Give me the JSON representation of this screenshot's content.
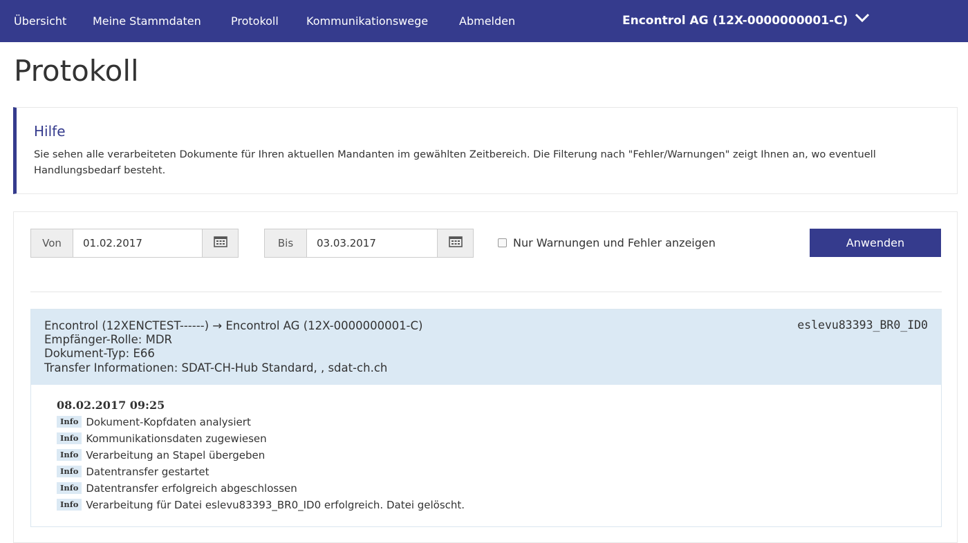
{
  "nav": {
    "items": [
      "Übersicht",
      "Meine Stammdaten",
      "Protokoll",
      "Kommunikationswege",
      "Abmelden"
    ],
    "tenant": "Encontrol AG (12X-0000000001-C)",
    "bg_color": "#353b8d"
  },
  "page": {
    "title": "Protokoll"
  },
  "help": {
    "title": "Hilfe",
    "text": "Sie sehen alle verarbeiteten Dokumente für Ihren aktuellen Mandanten im gewählten Zeitbereich. Die Filterung nach \"Fehler/Warnungen\" zeigt Ihnen an, wo eventuell Handlungsbedarf besteht."
  },
  "filter": {
    "from_label": "Von",
    "from_value": "01.02.2017",
    "to_label": "Bis",
    "to_value": "03.03.2017",
    "calendar_icon": "calendar-icon",
    "checkbox_label": "Nur Warnungen und Fehler anzeigen",
    "checkbox_checked": false,
    "apply_label": "Anwenden"
  },
  "entries": [
    {
      "route": "Encontrol (12XENCTEST------) → Encontrol AG (12X-0000000001-C)",
      "role": "Empfänger-Rolle: MDR",
      "doc_type": "Dokument-Typ: E66",
      "transfer": "Transfer Informationen: SDAT-CH-Hub Standard, , sdat-ch.ch",
      "file_id": "eslevu83393_BR0_ID0",
      "timestamp": "08.02.2017 09:25",
      "logs": [
        {
          "level": "Info",
          "text": "Dokument-Kopfdaten analysiert"
        },
        {
          "level": "Info",
          "text": "Kommunikationsdaten zugewiesen"
        },
        {
          "level": "Info",
          "text": "Verarbeitung an Stapel übergeben"
        },
        {
          "level": "Info",
          "text": "Datentransfer gestartet"
        },
        {
          "level": "Info",
          "text": "Datentransfer erfolgreich abgeschlossen"
        },
        {
          "level": "Info",
          "text": "Verarbeitung für Datei eslevu83393_BR0_ID0 erfolgreich. Datei gelöscht."
        }
      ]
    }
  ]
}
